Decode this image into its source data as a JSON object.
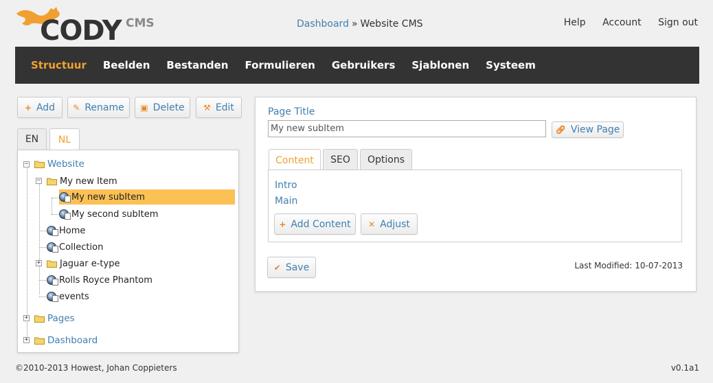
{
  "brand": {
    "name": "CODY",
    "suffix": "CMS",
    "accent": "#f0a030",
    "link_color": "#3f7fb0",
    "menu_bg": "#333333"
  },
  "breadcrumb": {
    "link": "Dashboard",
    "separator": "»",
    "current": "Website CMS"
  },
  "top_nav": [
    "Help",
    "Account",
    "Sign out"
  ],
  "main_menu": [
    {
      "label": "Structuur",
      "active": true
    },
    {
      "label": "Beelden"
    },
    {
      "label": "Bestanden"
    },
    {
      "label": "Formulieren"
    },
    {
      "label": "Gebruikers"
    },
    {
      "label": "Sjablonen"
    },
    {
      "label": "Systeem"
    }
  ],
  "toolbar": {
    "add": "Add",
    "rename": "Rename",
    "delete": "Delete",
    "edit": "Edit"
  },
  "language_tabs": [
    {
      "label": "EN"
    },
    {
      "label": "NL",
      "active": true
    }
  ],
  "tree": {
    "website": "Website",
    "my_new_item": "My new Item",
    "my_new_subitem": "My new subItem",
    "my_second_subitem": "My second subItem",
    "home": "Home",
    "collection": "Collection",
    "jaguar": "Jaguar e-type",
    "rolls": "Rolls Royce Phantom",
    "events": "events",
    "pages": "Pages",
    "dashboard": "Dashboard",
    "selected": "My new subItem"
  },
  "editor": {
    "page_title_label": "Page Title",
    "page_title_value": "My new subItem",
    "view_page": "View Page",
    "tabs": [
      {
        "label": "Content",
        "active": true
      },
      {
        "label": "SEO"
      },
      {
        "label": "Options"
      }
    ],
    "content_links": [
      "Intro",
      "Main"
    ],
    "add_content": "Add Content",
    "adjust": "Adjust",
    "save": "Save",
    "last_modified_label": "Last Modified:",
    "last_modified_value": "10-07-2013"
  },
  "footer": {
    "copyright": "©2010-2013 Howest, Johan Coppieters",
    "version": "v0.1a1"
  }
}
